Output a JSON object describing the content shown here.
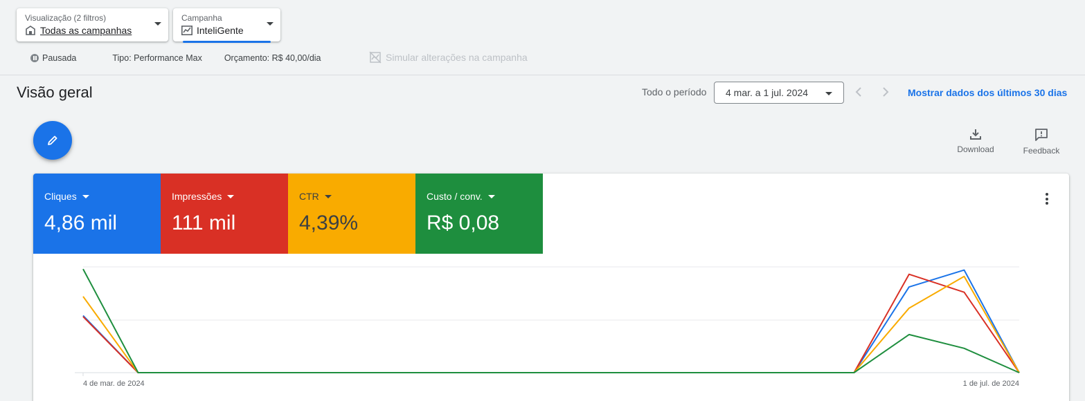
{
  "filters": {
    "view": {
      "label": "Visualização (2 filtros)",
      "value": "Todas as campanhas",
      "icon": "store-icon"
    },
    "campaign": {
      "label": "Campanha",
      "value": "InteliGente",
      "icon": "trending-icon"
    }
  },
  "status": {
    "state": "Pausada",
    "type_label": "Tipo:",
    "type_value": "Performance Max",
    "budget_label": "Orçamento:",
    "budget_value": "R$ 40,00/dia",
    "simulate": "Simular alterações na campanha"
  },
  "overview": {
    "title": "Visão geral",
    "period_label": "Todo o período",
    "date_range": "4 mar. a 1 jul. 2024",
    "last30": "Mostrar dados dos últimos 30 dias"
  },
  "actions": {
    "download": "Download",
    "feedback": "Feedback"
  },
  "metrics": [
    {
      "name": "Cliques",
      "value": "4,86 mil",
      "color": "#1a73e8"
    },
    {
      "name": "Impressões",
      "value": "111 mil",
      "color": "#d93025"
    },
    {
      "name": "CTR",
      "value": "4,39%",
      "color": "#f9ab00"
    },
    {
      "name": "Custo / conv.",
      "value": "R$ 0,08",
      "color": "#1e8e3e"
    }
  ],
  "chart_data": {
    "type": "line",
    "x_start_label": "4 de mar. de 2024",
    "x_end_label": "1 de jul. de 2024",
    "points_count": 18,
    "note": "",
    "series": [
      {
        "name": "Cliques",
        "color": "#1a73e8",
        "values": [
          0.54,
          0,
          0,
          0,
          0,
          0,
          0,
          0,
          0,
          0,
          0,
          0,
          0,
          0,
          0,
          0.81,
          0.97,
          0
        ]
      },
      {
        "name": "Impressões",
        "color": "#d93025",
        "values": [
          0.53,
          0,
          0,
          0,
          0,
          0,
          0,
          0,
          0,
          0,
          0,
          0,
          0,
          0,
          0,
          0.93,
          0.76,
          0
        ]
      },
      {
        "name": "CTR",
        "color": "#f9ab00",
        "values": [
          0.72,
          0,
          0,
          0,
          0,
          0,
          0,
          0,
          0,
          0,
          0,
          0,
          0,
          0,
          0,
          0.61,
          0.91,
          0
        ]
      },
      {
        "name": "Custo / conv.",
        "color": "#1e8e3e",
        "values": [
          0.98,
          0,
          0,
          0,
          0,
          0,
          0,
          0,
          0,
          0,
          0,
          0,
          0,
          0,
          0,
          0.36,
          0.23,
          0
        ]
      }
    ]
  }
}
